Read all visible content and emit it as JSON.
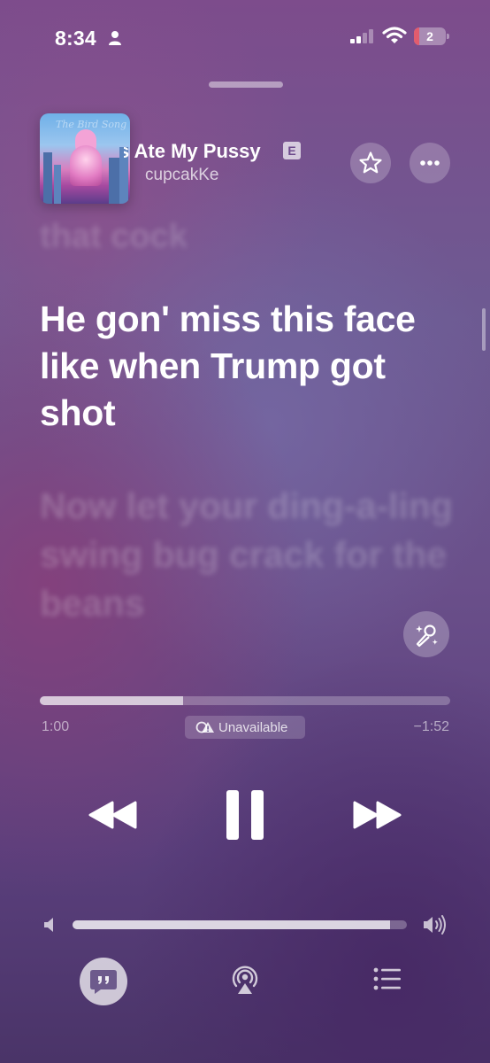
{
  "status_bar": {
    "time": "8:34",
    "battery_level": "2",
    "battery_fraction": 0.18,
    "icons": [
      "person-icon",
      "cellular-signal-icon",
      "wifi-icon",
      "battery-icon"
    ]
  },
  "now_playing": {
    "title_visible": "s Ate My Pussy",
    "explicit_badge": "E",
    "artist": "cupcakKe",
    "artwork_text": "The Bird Song",
    "buttons": {
      "favorite": "star-icon",
      "more": "ellipsis-icon"
    }
  },
  "lyrics": {
    "previous": "that cock",
    "current": "He gon' miss this face like when Trump got shot",
    "next": "Now let your ding-a-ling swing bug crack for the beans"
  },
  "playback": {
    "elapsed": "1:00",
    "remaining": "−1:52",
    "progress_fraction": 0.35,
    "audio_quality_label": "Unavailable",
    "state": "playing"
  },
  "volume": {
    "level_fraction": 0.95
  },
  "bottom_bar": {
    "items": [
      "lyrics-icon",
      "airplay-icon",
      "queue-icon"
    ],
    "active": "lyrics-icon"
  },
  "colors": {
    "background_top": "#7d4c8c",
    "background_bottom": "#4a3468",
    "battery_low": "#e25c6e"
  }
}
